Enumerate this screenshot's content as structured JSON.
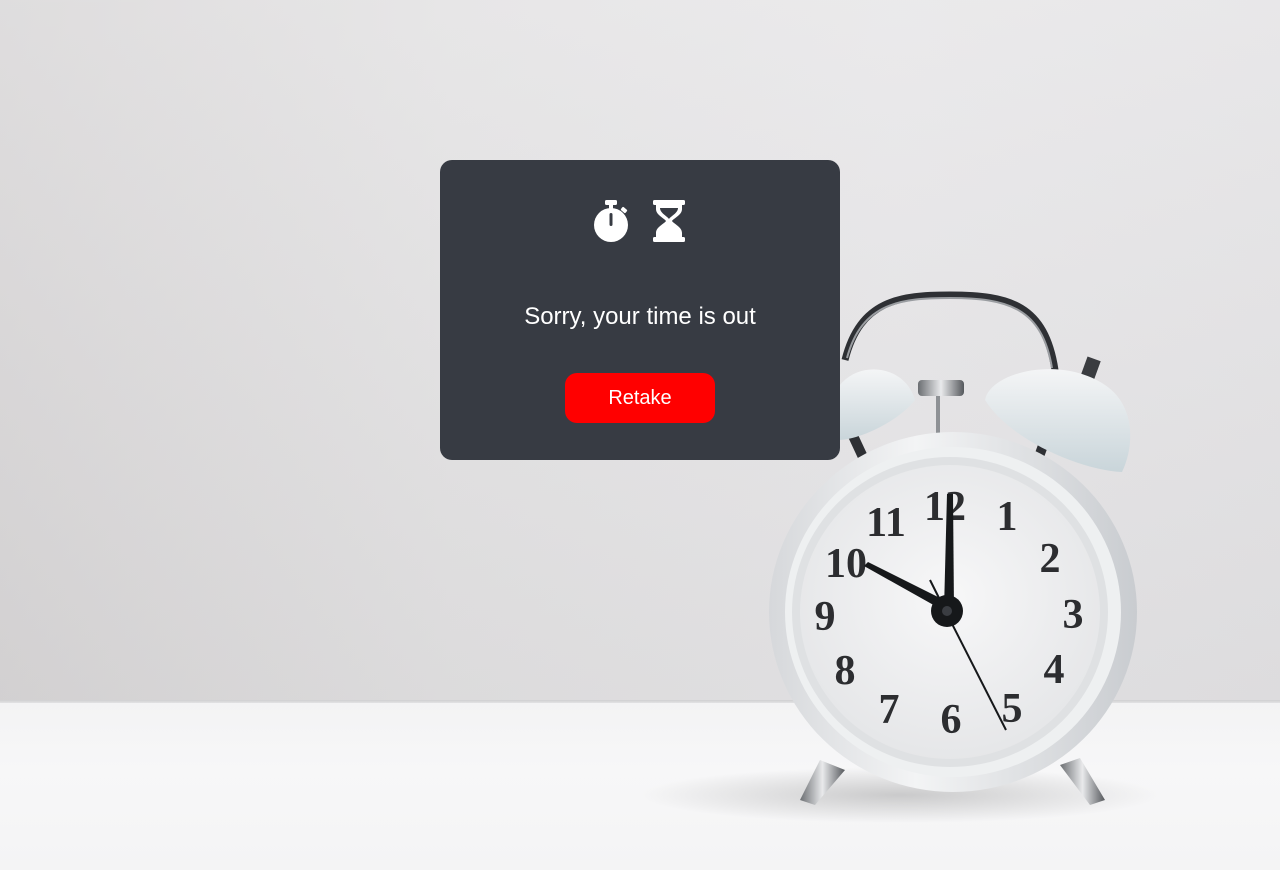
{
  "background": {
    "description_icon": "alarm-clock-photo",
    "clock_numerals": [
      "12",
      "1",
      "2",
      "3",
      "4",
      "5",
      "6",
      "7",
      "8",
      "9",
      "10",
      "11"
    ]
  },
  "dialog": {
    "icons": [
      "stopwatch-icon",
      "hourglass-icon"
    ],
    "message": "Sorry, your time is out",
    "retake_label": "Retake",
    "colors": {
      "panel": "#373b43",
      "button": "#ff0000",
      "text": "#ffffff"
    }
  }
}
